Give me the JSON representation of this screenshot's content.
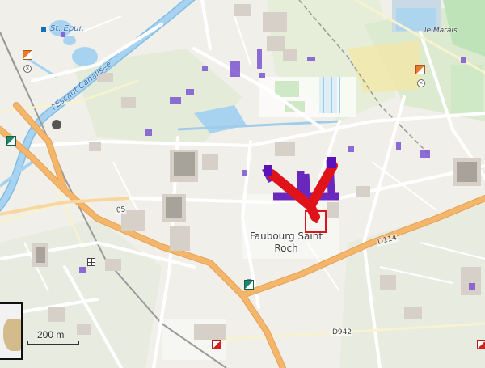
{
  "map": {
    "place_label": {
      "line1": "Faubourg Saint",
      "line2": "Roch"
    },
    "labels": {
      "st_epur": "St. Epur.",
      "le_marais": "le Marais",
      "canal": "l'Escaut Canalisée"
    },
    "roads": {
      "d114": "D114",
      "d942": "D942",
      "r05": "05"
    },
    "scale_text": "200 m",
    "colors": {
      "background": "#f1efe9",
      "major_road": "#f4b66a",
      "water": "#a8d3f0",
      "parks": "#cde8c4",
      "buildings": "#d6d0c8",
      "highlight_red": "#e0131a",
      "highlight_purple": "#5b12b8"
    },
    "icons": {
      "minimap": "minimap-thumbnail",
      "marker": "location-marker-icon"
    }
  }
}
